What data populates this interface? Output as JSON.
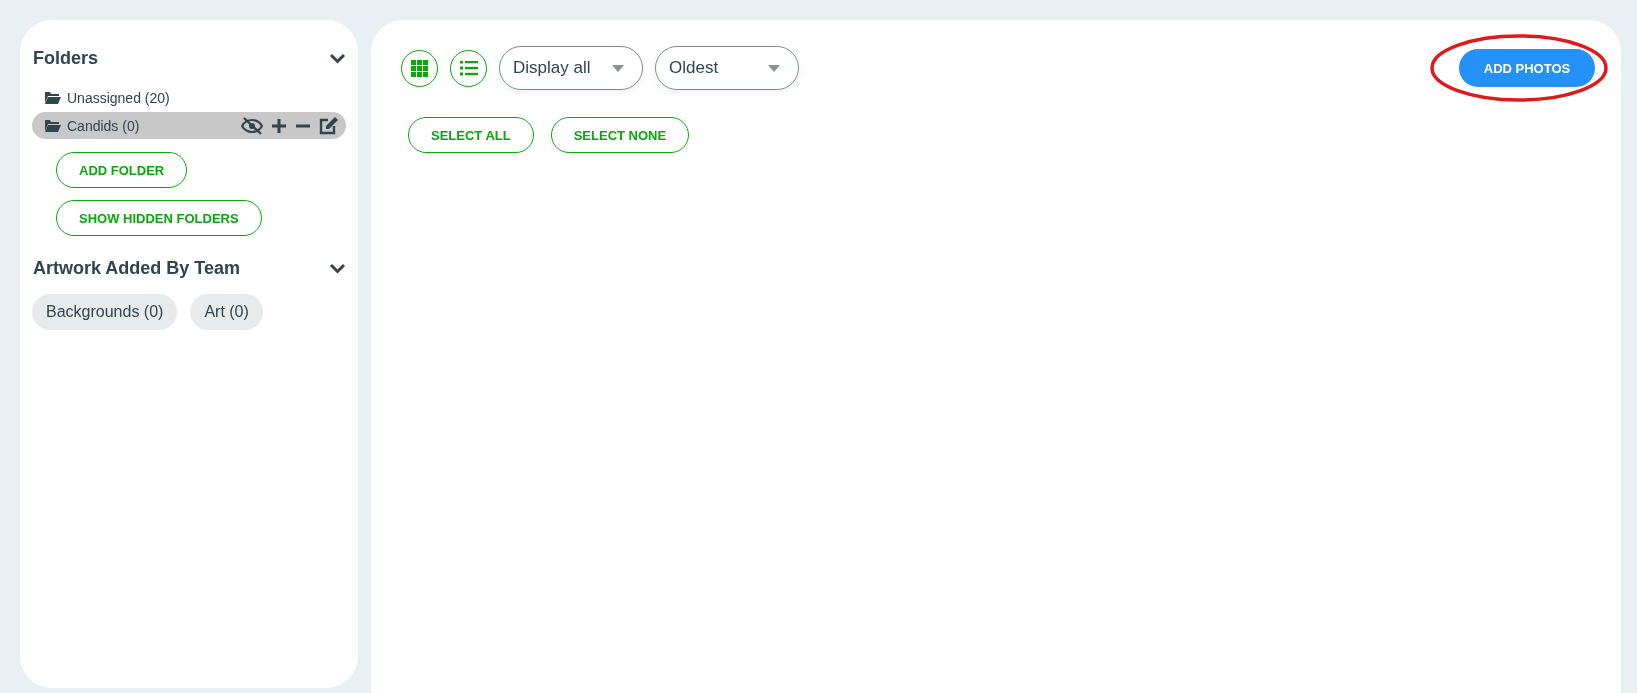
{
  "sidebar": {
    "sections": [
      {
        "title": "Folders",
        "expanded": true,
        "kind": "folders",
        "folders": [
          {
            "label": "Unassigned (20)",
            "selected": false
          },
          {
            "label": "Candids (0)",
            "selected": true
          }
        ],
        "buttons": [
          "ADD FOLDER",
          "SHOW HIDDEN FOLDERS"
        ]
      },
      {
        "title": "Artwork Added By Team",
        "expanded": true,
        "kind": "chips",
        "chips": [
          "Backgrounds (0)",
          "Art (0)"
        ]
      }
    ]
  },
  "toolbar": {
    "filters": [
      {
        "value": "Display all"
      },
      {
        "value": "Oldest"
      }
    ],
    "add_button": "ADD PHOTOS",
    "add_highlighted": true
  },
  "selection_buttons": [
    "SELECT ALL",
    "SELECT NONE"
  ]
}
